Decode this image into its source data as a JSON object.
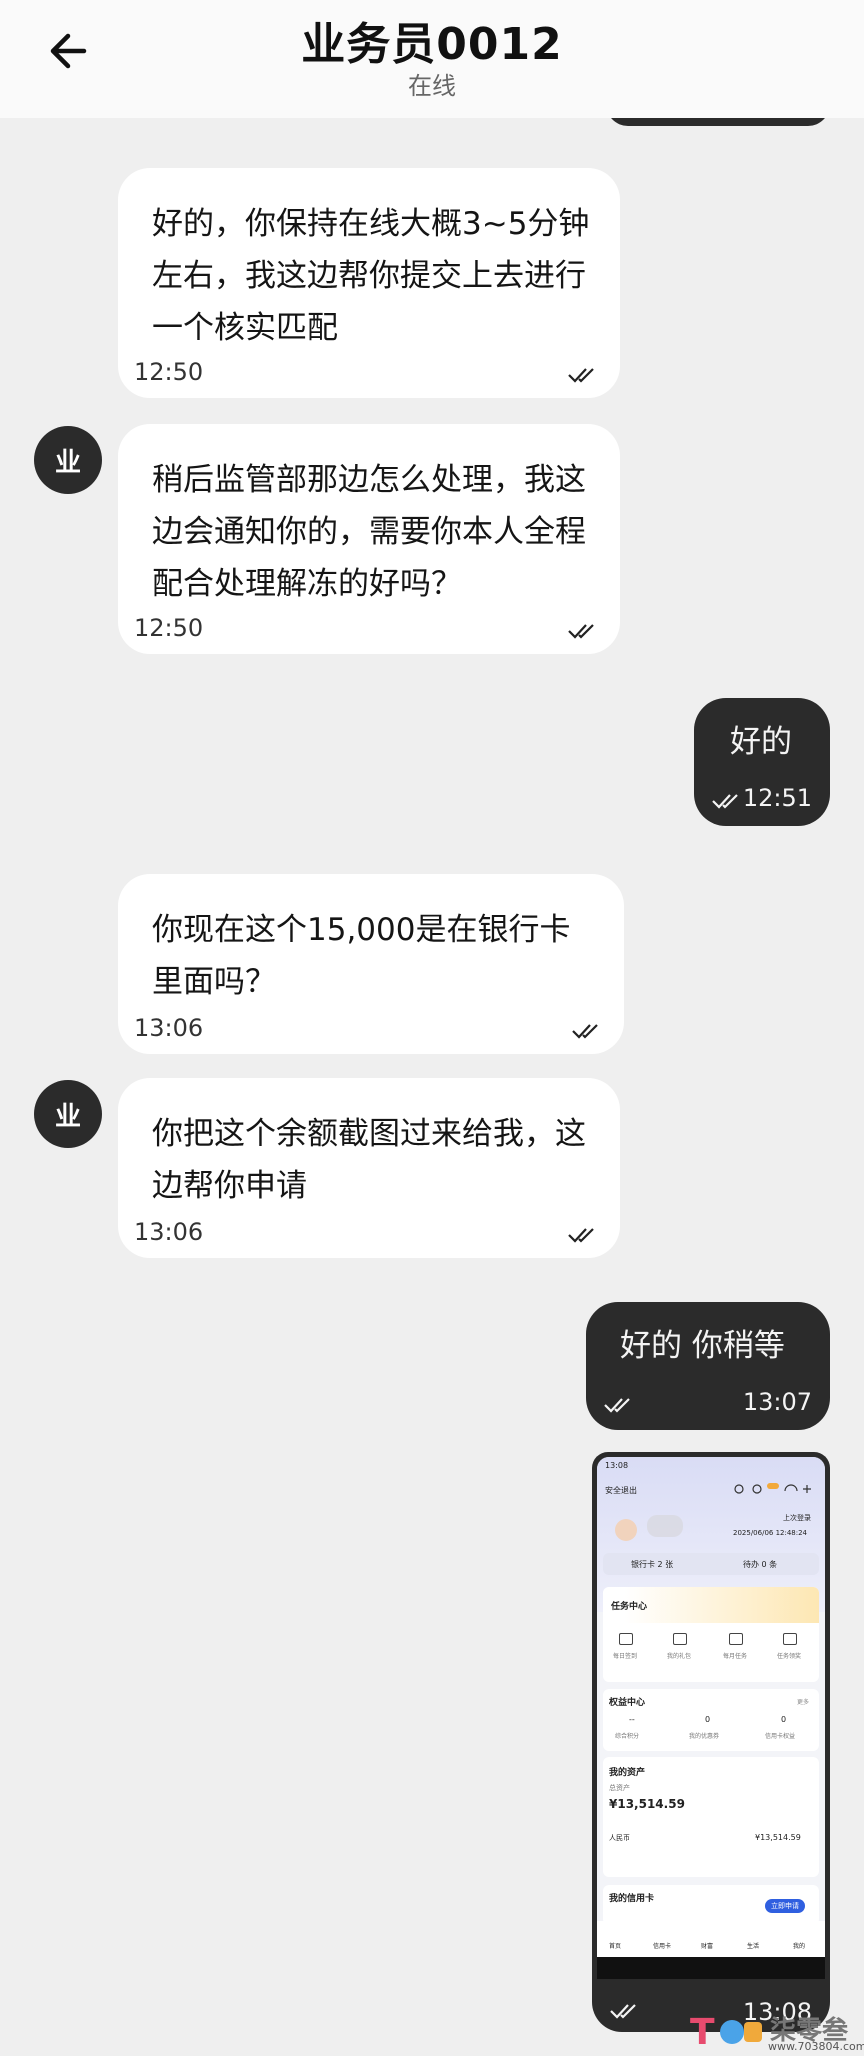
{
  "header": {
    "title": "业务员0012",
    "status": "在线"
  },
  "avatar_letter": "业",
  "messages": [
    {
      "dir": "in",
      "text": "好的，你保持在线大概3~5分钟左右，我这边帮你提交上去进行一个核实匹配",
      "time": "12:50"
    },
    {
      "dir": "in",
      "text": "稍后监管部那边怎么处理，我这边会通知你的，需要你本人全程配合处理解冻的好吗？",
      "time": "12:50"
    },
    {
      "dir": "out",
      "text": "好的",
      "time": "12:51"
    },
    {
      "dir": "in",
      "text": "你现在这个15,000是在银行卡里面吗？",
      "time": "13:06"
    },
    {
      "dir": "in",
      "text": "你把这个余额截图过来给我，这边帮你申请",
      "time": "13:06"
    },
    {
      "dir": "out",
      "text": "好的 你稍等",
      "time": "13:07"
    }
  ],
  "image_message": {
    "time": "13:08",
    "screenshot": {
      "status_time": "13:08",
      "logout": "安全退出",
      "last_login_label": "上次登录",
      "last_login": "2025/06/06 12:48:24",
      "bank_card": "银行卡 2 张",
      "pending": "待办 0 条",
      "task_center": "任务中心",
      "task_items": [
        "每日签到",
        "我的礼包",
        "每月任务",
        "任务领奖"
      ],
      "rights_center": "权益中心",
      "rights_more": "更多",
      "rights_values": [
        "--",
        "0",
        "0"
      ],
      "rights_labels": [
        "综合积分",
        "我的优惠券",
        "信用卡权益"
      ],
      "assets_title": "我的资产",
      "total_label": "总资产",
      "total_value": "¥13,514.59",
      "rmb_label": "人民币",
      "rmb_value": "¥13,514.59",
      "credit_title": "我的信用卡",
      "credit_button": "立即申请",
      "nav": [
        "首页",
        "信用卡",
        "财富",
        "生活",
        "我的"
      ]
    }
  },
  "watermark": {
    "text": "柒零叁",
    "url": "www.703804.com"
  }
}
